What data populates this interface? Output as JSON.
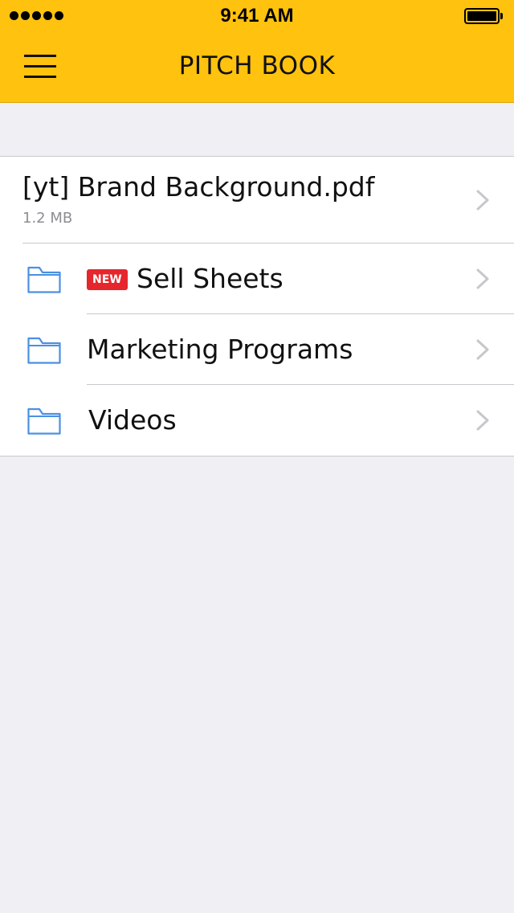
{
  "status_bar": {
    "time": "9:41 AM",
    "signal_bars": 5,
    "battery_level": 1.0
  },
  "header": {
    "title": "PITCH BOOK",
    "menu_icon": "hamburger-menu-icon",
    "background_color": "#ffc20e"
  },
  "list": {
    "file": {
      "name": "[yt] Brand Background.pdf",
      "size": "1.2 MB",
      "chevron_icon": "chevron-right-icon"
    },
    "folders": [
      {
        "label": "Sell Sheets",
        "badge": "NEW",
        "icon": "folder-icon"
      },
      {
        "label": "Marketing Programs",
        "icon": "folder-icon"
      },
      {
        "label": "Videos",
        "icon": "folder-icon"
      }
    ]
  },
  "colors": {
    "accent": "#ffc20e",
    "badge": "#e5262c",
    "folder_icon": "#4a90e2",
    "chevron": "#c7c7cc",
    "background": "#efeff4"
  }
}
